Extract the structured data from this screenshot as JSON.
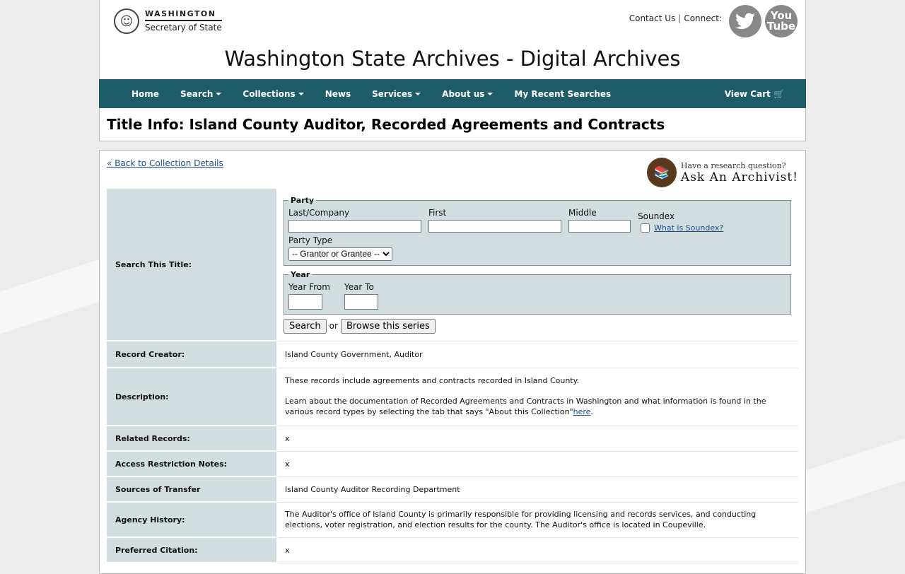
{
  "header": {
    "logo_line1": "WASHINGTON",
    "logo_line2": "Secretary of State",
    "contact": "Contact Us",
    "connect": "Connect:",
    "twitter_icon": "twitter-icon",
    "youtube_line1": "You",
    "youtube_line2": "Tube",
    "site_title": "Washington State Archives - Digital Archives"
  },
  "nav": {
    "items": [
      "Home",
      "Search",
      "Collections",
      "News",
      "Services",
      "About us",
      "My Recent Searches"
    ],
    "cart": "View Cart 🛒"
  },
  "page_title": "Title Info: Island County Auditor, Recorded Agreements and Contracts",
  "back_link": "« Back to Collection Details",
  "ask": {
    "line1": "Have a research question?",
    "line2": "Ask An Archivist!"
  },
  "search": {
    "label": "Search This Title:",
    "party_legend": "Party",
    "last_label": "Last/Company",
    "first_label": "First",
    "middle_label": "Middle",
    "soundex_label": "Soundex",
    "soundex_link": "What is Soundex?",
    "party_type_label": "Party Type",
    "party_type_selected": "-- Grantor or Grantee --",
    "year_legend": "Year",
    "year_from_label": "Year From",
    "year_to_label": "Year To",
    "search_button": "Search",
    "or": "or",
    "browse_button": "Browse this series"
  },
  "rows": {
    "record_creator": {
      "label": "Record Creator:",
      "value": "Island County Government, Auditor"
    },
    "description": {
      "label": "Description:",
      "p1": "These records include agreements and contracts recorded in Island County.",
      "p2": "Learn about the documentation of Recorded Agreements and Contracts in Washington and what information is found in the various record types by selecting the tab that says \"About this Collection\"",
      "link": "here",
      "end": "."
    },
    "related": {
      "label": "Related Records:",
      "value": "x"
    },
    "access": {
      "label": "Access Restriction Notes:",
      "value": "x"
    },
    "sources": {
      "label": "Sources of Transfer",
      "value": "Island County Auditor Recording Department"
    },
    "agency": {
      "label": "Agency History:",
      "value": "The Auditor's office of Island County is primarily responsible for providing licensing and records services, and conducting elections, voter registration, and election results for the county. The Auditor's office is located in Coupeville."
    },
    "citation": {
      "label": "Preferred Citation:",
      "value": "x"
    }
  }
}
